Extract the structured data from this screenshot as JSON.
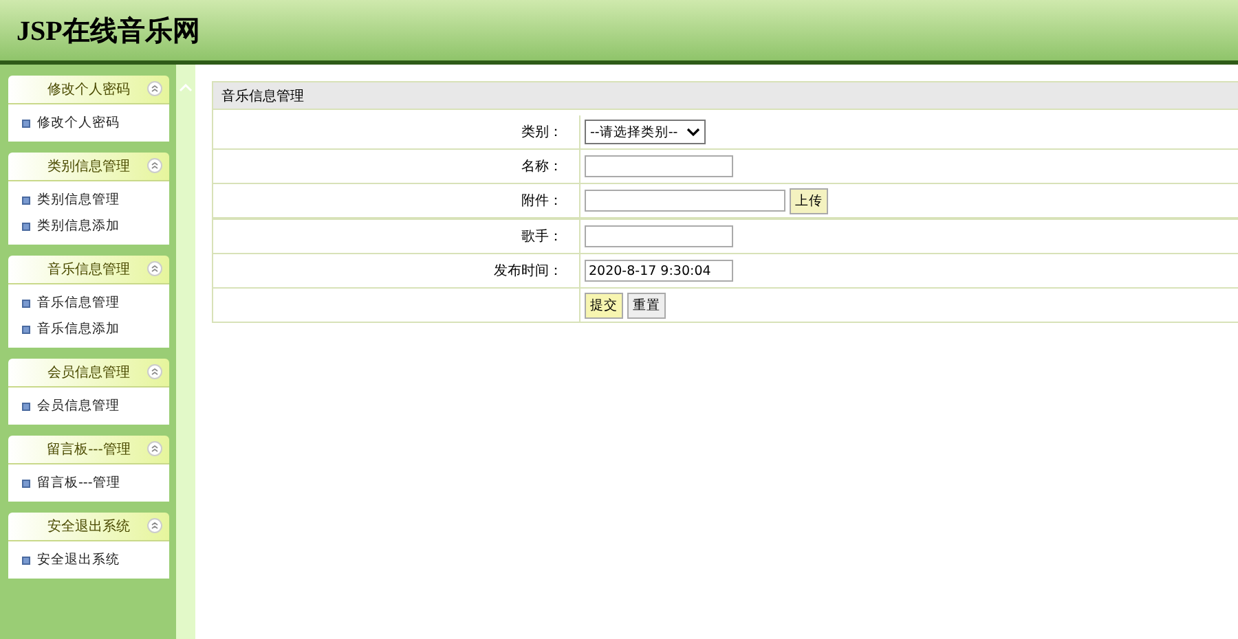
{
  "site_title": "JSP在线音乐网",
  "menu": [
    {
      "title": "修改个人密码",
      "items": [
        "修改个人密码"
      ]
    },
    {
      "title": "类别信息管理",
      "items": [
        "类别信息管理",
        "类别信息添加"
      ]
    },
    {
      "title": "音乐信息管理",
      "items": [
        "音乐信息管理",
        "音乐信息添加"
      ]
    },
    {
      "title": "会员信息管理",
      "items": [
        "会员信息管理"
      ]
    },
    {
      "title": "留言板---管理",
      "items": [
        "留言板---管理"
      ]
    },
    {
      "title": "安全退出系统",
      "items": [
        "安全退出系统"
      ]
    }
  ],
  "panel_title": "音乐信息管理",
  "form": [
    {
      "kind": "select",
      "label": "类别：",
      "value": "--请选择类别--"
    },
    {
      "kind": "text",
      "label": "名称："
    },
    {
      "kind": "upload",
      "label": "附件：",
      "button": "上传"
    },
    {
      "kind": "text",
      "label": "歌手："
    },
    {
      "kind": "text",
      "label": "发布时间：",
      "value": "2020-8-17 9:30:04"
    },
    {
      "kind": "buttons",
      "buttons": [
        "提交",
        "重置"
      ]
    }
  ]
}
